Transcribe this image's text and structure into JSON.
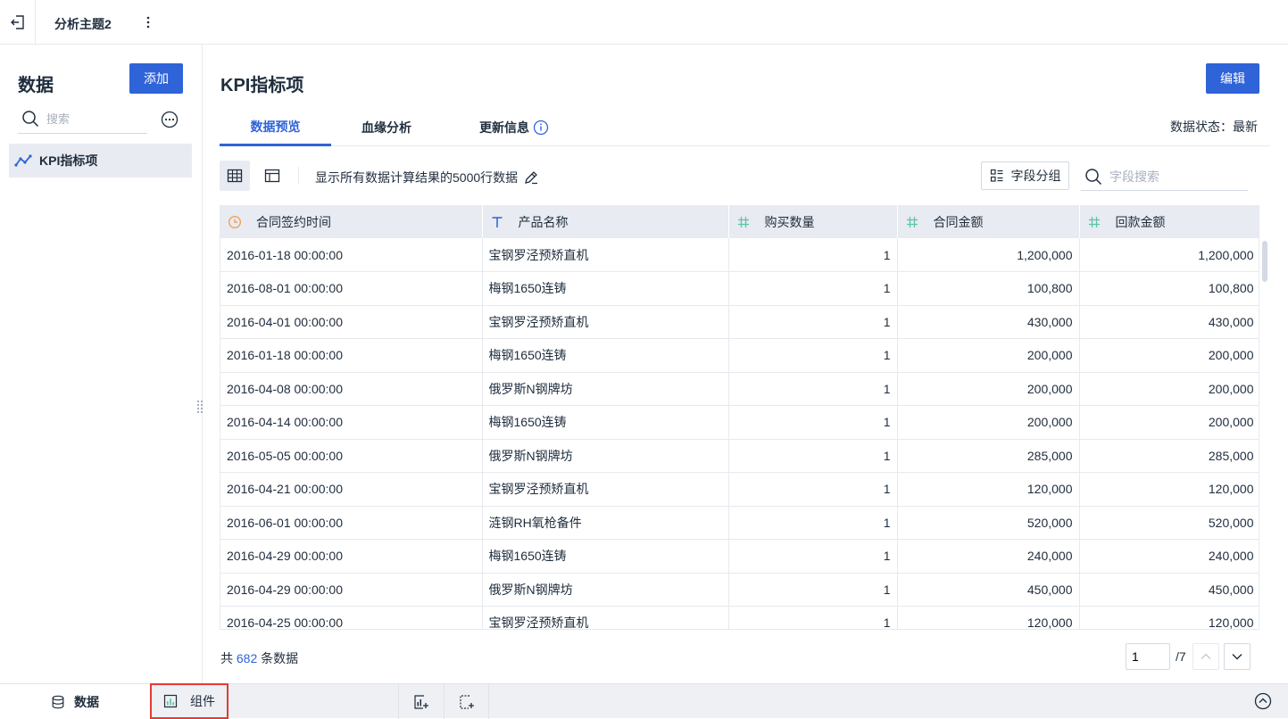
{
  "topbar": {
    "title": "分析主题2"
  },
  "sidebar": {
    "title": "数据",
    "add_label": "添加",
    "search_placeholder": "搜索",
    "items": [
      {
        "label": "KPI指标项"
      }
    ]
  },
  "main": {
    "title": "KPI指标项",
    "edit_label": "编辑",
    "tabs": [
      {
        "label": "数据预览",
        "active": true
      },
      {
        "label": "血缘分析",
        "active": false
      },
      {
        "label": "更新信息",
        "active": false
      }
    ],
    "data_status": "数据状态：最新",
    "toolbar": {
      "description": "显示所有数据计算结果的5000行数据",
      "group_label": "字段分组",
      "field_search_placeholder": "字段搜索"
    },
    "table": {
      "columns": [
        {
          "label": "合同签约时间",
          "type": "date",
          "icon": "clock-icon"
        },
        {
          "label": "产品名称",
          "type": "text",
          "icon": "text-type-icon"
        },
        {
          "label": "购买数量",
          "type": "number",
          "icon": "hash-icon"
        },
        {
          "label": "合同金额",
          "type": "number",
          "icon": "hash-icon"
        },
        {
          "label": "回款金额",
          "type": "number",
          "icon": "hash-icon"
        }
      ],
      "rows": [
        [
          "2016-01-18 00:00:00",
          "宝钢罗泾预矫直机",
          "1",
          "1,200,000",
          "1,200,000"
        ],
        [
          "2016-08-01 00:00:00",
          "梅钢1650连铸",
          "1",
          "100,800",
          "100,800"
        ],
        [
          "2016-04-01 00:00:00",
          "宝钢罗泾预矫直机",
          "1",
          "430,000",
          "430,000"
        ],
        [
          "2016-01-18 00:00:00",
          "梅钢1650连铸",
          "1",
          "200,000",
          "200,000"
        ],
        [
          "2016-04-08 00:00:00",
          "俄罗斯N钢牌坊",
          "1",
          "200,000",
          "200,000"
        ],
        [
          "2016-04-14 00:00:00",
          "梅钢1650连铸",
          "1",
          "200,000",
          "200,000"
        ],
        [
          "2016-05-05 00:00:00",
          "俄罗斯N钢牌坊",
          "1",
          "285,000",
          "285,000"
        ],
        [
          "2016-04-21 00:00:00",
          "宝钢罗泾预矫直机",
          "1",
          "120,000",
          "120,000"
        ],
        [
          "2016-06-01 00:00:00",
          "涟钢RH氧枪备件",
          "1",
          "520,000",
          "520,000"
        ],
        [
          "2016-04-29 00:00:00",
          "梅钢1650连铸",
          "1",
          "240,000",
          "240,000"
        ],
        [
          "2016-04-29 00:00:00",
          "俄罗斯N钢牌坊",
          "1",
          "450,000",
          "450,000"
        ],
        [
          "2016-04-25 00:00:00",
          "宝钢罗泾预矫直机",
          "1",
          "120,000",
          "120,000"
        ]
      ]
    },
    "footer": {
      "total_prefix": "共",
      "total_count": "682",
      "total_suffix": "条数据",
      "page_value": "1",
      "page_total": "/7"
    }
  },
  "bottombar": {
    "data_tab": "数据",
    "component_tab": "组件"
  },
  "colors": {
    "primary": "#2f63d8",
    "date_icon": "#f0a05a",
    "number_icon": "#5bc4a8",
    "text_icon": "#2f63d8",
    "highlight_border": "#e53935"
  }
}
